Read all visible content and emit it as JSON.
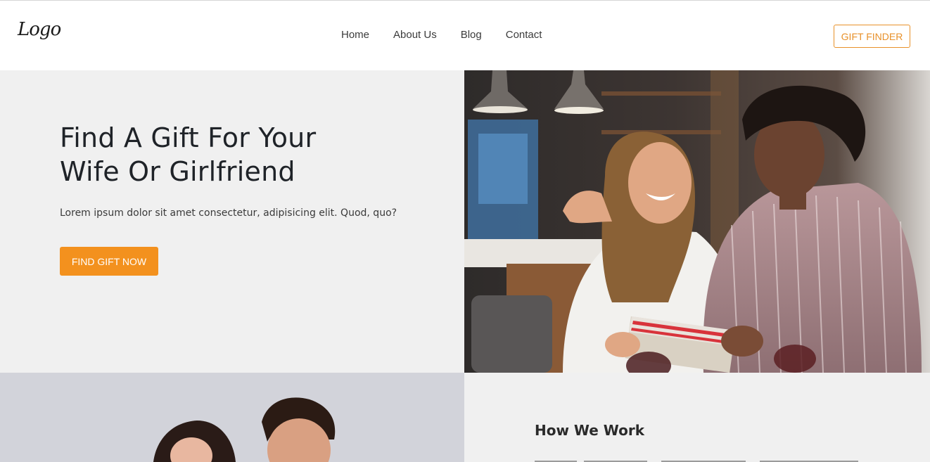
{
  "header": {
    "logo": "Logo",
    "nav": [
      "Home",
      "About Us",
      "Blog",
      "Contact"
    ],
    "cta": "GIFT FINDER"
  },
  "hero": {
    "title_line1": "Find A Gift For Your",
    "title_line2": "Wife Or Girlfriend",
    "text": "Lorem ipsum dolor sit amet consectetur, adipisicing elit. Quod, quo?",
    "button": "FIND GIFT NOW"
  },
  "how": {
    "title": "How We Work"
  },
  "colors": {
    "accent": "#f3911e",
    "section_bg": "#f0f0f0"
  }
}
